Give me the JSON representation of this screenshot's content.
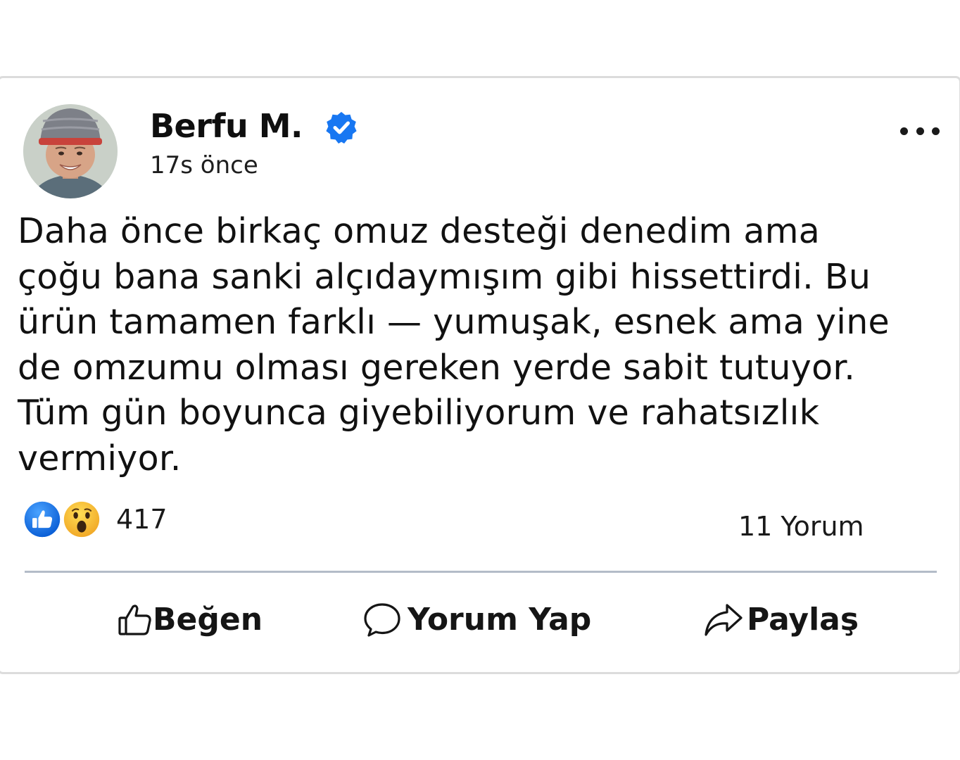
{
  "post": {
    "author": {
      "name": "Berfu M.",
      "verified": true,
      "avatar_icon": "profile-photo"
    },
    "timestamp": "17s önce",
    "menu_icon": "more-options-icon",
    "text": "Daha önce birkaç omuz desteği denedim ama çoğu bana sanki alçıdaymışım gibi hissettirdi. Bu ürün tamamen farklı — yumuşak, esnek ama yine de omzumu olması gereken yerde sabit tutuyor. Tüm gün boyunca giyebiliyorum ve rahatsızlık vermiyor.",
    "reactions": {
      "icons": [
        "like-icon",
        "wow-icon"
      ],
      "count": "417"
    },
    "comments": {
      "label": "11 Yorum"
    },
    "actions": {
      "like": "Beğen",
      "comment": "Yorum Yap",
      "share": "Paylaş"
    }
  },
  "colors": {
    "verified_blue": "#1877f2",
    "like_blue": "#1877f2",
    "wow_yellow": "#f7c13a",
    "divider": "#b3bcc8",
    "card_border": "#dcdcdc"
  }
}
